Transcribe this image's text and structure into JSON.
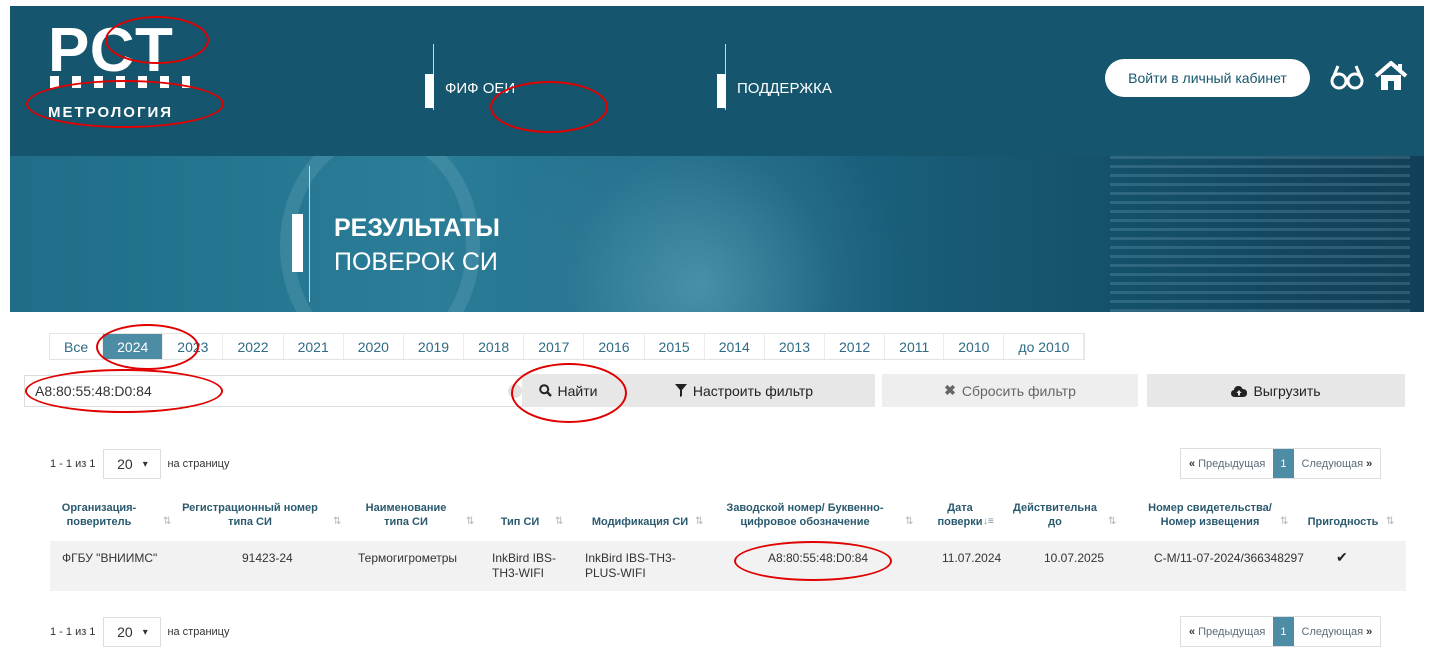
{
  "header": {
    "logo_main": "РСТ",
    "logo_sub": "МЕТРОЛОГИЯ",
    "nav": [
      {
        "label": "ФИФ ОЕИ"
      },
      {
        "label": "ПОДДЕРЖКА"
      }
    ],
    "login_label": "Войти в личный кабинет"
  },
  "banner": {
    "title_line1": "РЕЗУЛЬТАТЫ",
    "title_line2": "ПОВЕРОК СИ"
  },
  "years": [
    "Все",
    "2024",
    "2023",
    "2022",
    "2021",
    "2020",
    "2019",
    "2018",
    "2017",
    "2016",
    "2015",
    "2014",
    "2013",
    "2012",
    "2011",
    "2010",
    "до 2010"
  ],
  "active_year": "2024",
  "search": {
    "value": "A8:80:55:48:D0:84",
    "find_label": "Найти",
    "filter_label": "Настроить фильтр",
    "reset_label": "Сбросить фильтр",
    "export_label": "Выгрузить"
  },
  "pagination": {
    "range": "1 - 1 из 1",
    "per_page": "20",
    "per_page_suffix": "на страницу",
    "prev": "Предыдущая",
    "current": "1",
    "next": "Следующая"
  },
  "table": {
    "headers": {
      "org": [
        "Организация-",
        "поверитель"
      ],
      "reg": [
        "Регистрационный номер",
        "типа СИ"
      ],
      "name": [
        "Наименование",
        "типа СИ"
      ],
      "type": [
        "Тип СИ"
      ],
      "mod": [
        "Модификация СИ"
      ],
      "serial": [
        "Заводской номер/ Буквенно-",
        "цифровое обозначение"
      ],
      "date": [
        "Дата",
        "поверки"
      ],
      "valid": [
        "Действительна",
        "до"
      ],
      "cert": [
        "Номер свидетельства/",
        "Номер извещения"
      ],
      "fit": [
        "Пригодность"
      ]
    },
    "row": {
      "org": "ФГБУ \"ВНИИМС\"",
      "reg": "91423-24",
      "name": "Термогигрометры",
      "type": [
        "InkBird IBS-",
        "TH3-WIFI"
      ],
      "mod": [
        "InkBird IBS-TH3-",
        "PLUS-WIFI"
      ],
      "serial": "A8:80:55:48:D0:84",
      "date": "11.07.2024",
      "valid": "10.07.2025",
      "cert": "С-М/11-07-2024/366348297",
      "fit": "✔"
    }
  },
  "colors": {
    "header_bg": "#15556d",
    "accent": "#4d8ca5",
    "annotation": "#e00000"
  }
}
